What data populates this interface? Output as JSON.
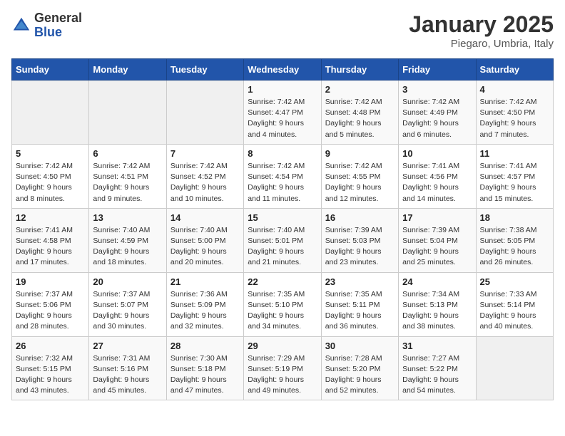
{
  "header": {
    "logo_general": "General",
    "logo_blue": "Blue",
    "month_title": "January 2025",
    "location": "Piegaro, Umbria, Italy"
  },
  "days_of_week": [
    "Sunday",
    "Monday",
    "Tuesday",
    "Wednesday",
    "Thursday",
    "Friday",
    "Saturday"
  ],
  "weeks": [
    [
      {
        "day": "",
        "info": ""
      },
      {
        "day": "",
        "info": ""
      },
      {
        "day": "",
        "info": ""
      },
      {
        "day": "1",
        "info": "Sunrise: 7:42 AM\nSunset: 4:47 PM\nDaylight: 9 hours\nand 4 minutes."
      },
      {
        "day": "2",
        "info": "Sunrise: 7:42 AM\nSunset: 4:48 PM\nDaylight: 9 hours\nand 5 minutes."
      },
      {
        "day": "3",
        "info": "Sunrise: 7:42 AM\nSunset: 4:49 PM\nDaylight: 9 hours\nand 6 minutes."
      },
      {
        "day": "4",
        "info": "Sunrise: 7:42 AM\nSunset: 4:50 PM\nDaylight: 9 hours\nand 7 minutes."
      }
    ],
    [
      {
        "day": "5",
        "info": "Sunrise: 7:42 AM\nSunset: 4:50 PM\nDaylight: 9 hours\nand 8 minutes."
      },
      {
        "day": "6",
        "info": "Sunrise: 7:42 AM\nSunset: 4:51 PM\nDaylight: 9 hours\nand 9 minutes."
      },
      {
        "day": "7",
        "info": "Sunrise: 7:42 AM\nSunset: 4:52 PM\nDaylight: 9 hours\nand 10 minutes."
      },
      {
        "day": "8",
        "info": "Sunrise: 7:42 AM\nSunset: 4:54 PM\nDaylight: 9 hours\nand 11 minutes."
      },
      {
        "day": "9",
        "info": "Sunrise: 7:42 AM\nSunset: 4:55 PM\nDaylight: 9 hours\nand 12 minutes."
      },
      {
        "day": "10",
        "info": "Sunrise: 7:41 AM\nSunset: 4:56 PM\nDaylight: 9 hours\nand 14 minutes."
      },
      {
        "day": "11",
        "info": "Sunrise: 7:41 AM\nSunset: 4:57 PM\nDaylight: 9 hours\nand 15 minutes."
      }
    ],
    [
      {
        "day": "12",
        "info": "Sunrise: 7:41 AM\nSunset: 4:58 PM\nDaylight: 9 hours\nand 17 minutes."
      },
      {
        "day": "13",
        "info": "Sunrise: 7:40 AM\nSunset: 4:59 PM\nDaylight: 9 hours\nand 18 minutes."
      },
      {
        "day": "14",
        "info": "Sunrise: 7:40 AM\nSunset: 5:00 PM\nDaylight: 9 hours\nand 20 minutes."
      },
      {
        "day": "15",
        "info": "Sunrise: 7:40 AM\nSunset: 5:01 PM\nDaylight: 9 hours\nand 21 minutes."
      },
      {
        "day": "16",
        "info": "Sunrise: 7:39 AM\nSunset: 5:03 PM\nDaylight: 9 hours\nand 23 minutes."
      },
      {
        "day": "17",
        "info": "Sunrise: 7:39 AM\nSunset: 5:04 PM\nDaylight: 9 hours\nand 25 minutes."
      },
      {
        "day": "18",
        "info": "Sunrise: 7:38 AM\nSunset: 5:05 PM\nDaylight: 9 hours\nand 26 minutes."
      }
    ],
    [
      {
        "day": "19",
        "info": "Sunrise: 7:37 AM\nSunset: 5:06 PM\nDaylight: 9 hours\nand 28 minutes."
      },
      {
        "day": "20",
        "info": "Sunrise: 7:37 AM\nSunset: 5:07 PM\nDaylight: 9 hours\nand 30 minutes."
      },
      {
        "day": "21",
        "info": "Sunrise: 7:36 AM\nSunset: 5:09 PM\nDaylight: 9 hours\nand 32 minutes."
      },
      {
        "day": "22",
        "info": "Sunrise: 7:35 AM\nSunset: 5:10 PM\nDaylight: 9 hours\nand 34 minutes."
      },
      {
        "day": "23",
        "info": "Sunrise: 7:35 AM\nSunset: 5:11 PM\nDaylight: 9 hours\nand 36 minutes."
      },
      {
        "day": "24",
        "info": "Sunrise: 7:34 AM\nSunset: 5:13 PM\nDaylight: 9 hours\nand 38 minutes."
      },
      {
        "day": "25",
        "info": "Sunrise: 7:33 AM\nSunset: 5:14 PM\nDaylight: 9 hours\nand 40 minutes."
      }
    ],
    [
      {
        "day": "26",
        "info": "Sunrise: 7:32 AM\nSunset: 5:15 PM\nDaylight: 9 hours\nand 43 minutes."
      },
      {
        "day": "27",
        "info": "Sunrise: 7:31 AM\nSunset: 5:16 PM\nDaylight: 9 hours\nand 45 minutes."
      },
      {
        "day": "28",
        "info": "Sunrise: 7:30 AM\nSunset: 5:18 PM\nDaylight: 9 hours\nand 47 minutes."
      },
      {
        "day": "29",
        "info": "Sunrise: 7:29 AM\nSunset: 5:19 PM\nDaylight: 9 hours\nand 49 minutes."
      },
      {
        "day": "30",
        "info": "Sunrise: 7:28 AM\nSunset: 5:20 PM\nDaylight: 9 hours\nand 52 minutes."
      },
      {
        "day": "31",
        "info": "Sunrise: 7:27 AM\nSunset: 5:22 PM\nDaylight: 9 hours\nand 54 minutes."
      },
      {
        "day": "",
        "info": ""
      }
    ]
  ]
}
